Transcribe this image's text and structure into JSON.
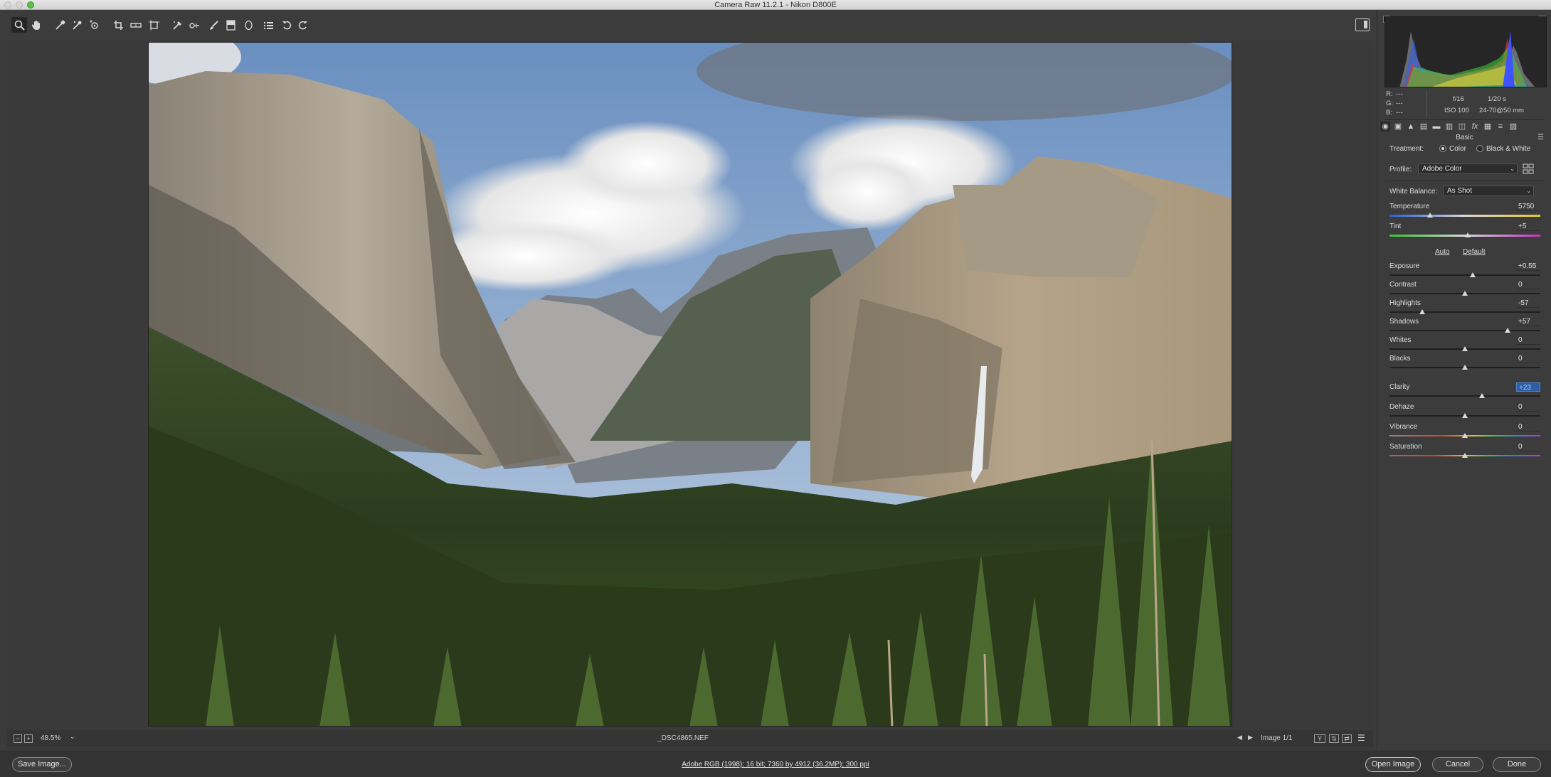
{
  "window": {
    "title": "Camera Raw 11.2.1  -  Nikon D800E"
  },
  "toolbar": {
    "tools": [
      {
        "name": "zoom-tool",
        "icon": "magnifier-icon"
      },
      {
        "name": "hand-tool",
        "icon": "hand-icon"
      },
      {
        "name": "white-balance-tool",
        "icon": "eyedropper-icon"
      },
      {
        "name": "color-sampler-tool",
        "icon": "sampler-icon"
      },
      {
        "name": "targeted-adjustment-tool",
        "icon": "target-icon"
      },
      {
        "name": "crop-tool",
        "icon": "crop-icon"
      },
      {
        "name": "straighten-tool",
        "icon": "level-icon"
      },
      {
        "name": "transform-tool",
        "icon": "transform-icon"
      },
      {
        "name": "spot-removal-tool",
        "icon": "brush-heal-icon"
      },
      {
        "name": "red-eye-tool",
        "icon": "eye-icon"
      },
      {
        "name": "adjustment-brush-tool",
        "icon": "brush-icon"
      },
      {
        "name": "graduated-filter-tool",
        "icon": "gradient-icon"
      },
      {
        "name": "radial-filter-tool",
        "icon": "ellipse-icon"
      },
      {
        "name": "preferences-tool",
        "icon": "list-icon"
      },
      {
        "name": "rotate-ccw-tool",
        "icon": "rotate-left-icon"
      },
      {
        "name": "rotate-cw-tool",
        "icon": "rotate-right-icon"
      }
    ]
  },
  "status": {
    "zoom": "48.5%",
    "filename": "_DSC4865.NEF",
    "image_counter": "Image 1/1"
  },
  "footer": {
    "save_label": "Save Image...",
    "workflow_info": "Adobe RGB (1998); 16 bit; 7360 by 4912 (36.2MP); 300 ppi",
    "open_label": "Open Image",
    "cancel_label": "Cancel",
    "done_label": "Done"
  },
  "histogram_info": {
    "r_label": "R:",
    "r_value": "---",
    "g_label": "G:",
    "g_value": "---",
    "b_label": "B:",
    "b_value": "---",
    "aperture": "f/16",
    "shutter": "1/20 s",
    "iso": "ISO 100",
    "lens": "24-70@50 mm"
  },
  "panel": {
    "title": "Basic",
    "treatment_label": "Treatment:",
    "treatment_color": "Color",
    "treatment_bw": "Black & White",
    "profile_label": "Profile:",
    "profile_value": "Adobe Color",
    "wb_label": "White Balance:",
    "wb_value": "As Shot",
    "auto_label": "Auto",
    "default_label": "Default",
    "sliders": [
      {
        "label": "Temperature",
        "value": "5750",
        "position": 0.27,
        "track": "temp"
      },
      {
        "label": "Tint",
        "value": "+5",
        "position": 0.52,
        "track": "tint"
      },
      {
        "label": "Exposure",
        "value": "+0.55",
        "position": 0.55,
        "track": "plain"
      },
      {
        "label": "Contrast",
        "value": "0",
        "position": 0.5,
        "track": "plain"
      },
      {
        "label": "Highlights",
        "value": "-57",
        "position": 0.215,
        "track": "plain"
      },
      {
        "label": "Shadows",
        "value": "+57",
        "position": 0.785,
        "track": "plain"
      },
      {
        "label": "Whites",
        "value": "0",
        "position": 0.5,
        "track": "plain"
      },
      {
        "label": "Blacks",
        "value": "0",
        "position": 0.5,
        "track": "plain"
      },
      {
        "label": "Clarity",
        "value": "+23",
        "position": 0.615,
        "track": "plain",
        "editing": true
      },
      {
        "label": "Dehaze",
        "value": "0",
        "position": 0.5,
        "track": "plain"
      },
      {
        "label": "Vibrance",
        "value": "0",
        "position": 0.5,
        "track": "vib"
      },
      {
        "label": "Saturation",
        "value": "0",
        "position": 0.5,
        "track": "sat"
      }
    ]
  }
}
